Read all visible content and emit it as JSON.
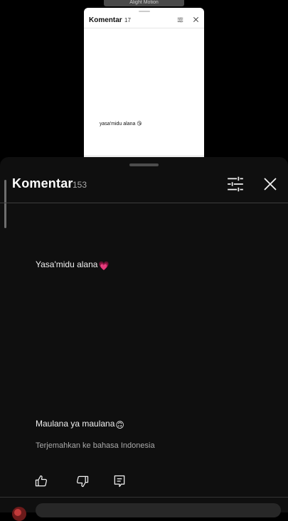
{
  "video": {
    "watermark": "Alight Motion",
    "mini_sheet": {
      "title": "Komentar",
      "count": "17",
      "comment": "yasa'midu alana 😘"
    }
  },
  "sheet": {
    "title": "Komentar",
    "count": "153",
    "filter_icon": "tune-icon",
    "close_icon": "close-icon"
  },
  "comments": [
    {
      "text": "Yasa'midu alana",
      "emoji": "💗"
    },
    {
      "text": "Maulana ya maulana",
      "emoji": "🙃"
    }
  ],
  "translate_label": "Terjemahkan ke bahasa Indonesia",
  "actions": {
    "like_icon": "thumbs-up-icon",
    "dislike_icon": "thumbs-down-icon",
    "reply_icon": "reply-icon"
  },
  "colors": {
    "sheet_bg": "#0f0f0f",
    "heart": "#e83e8c",
    "secondary_text": "#aaaaaa"
  }
}
